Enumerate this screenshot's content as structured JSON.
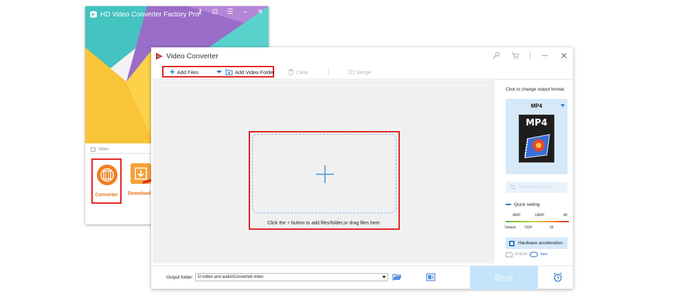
{
  "back_window": {
    "title": "HD Video Converter Factory Pro",
    "section_label": "Video",
    "tiles": [
      {
        "label": "Converter"
      },
      {
        "label": "Downloade"
      }
    ]
  },
  "main_window": {
    "title": "Video Converter",
    "toolbar": {
      "add_files": "Add Files",
      "add_video_folder": "Add Video Folder",
      "clear": "Clear",
      "merge": "Merge"
    },
    "drop_area": {
      "hint": "Click the + button to add files/folder,or drag files here."
    },
    "right_panel": {
      "output_format_label": "Click to change output format:",
      "format_name": "MP4",
      "format_thumb_text": "MP4",
      "edit_button": "Parameter settings",
      "quick_setting_label": "Quick setting",
      "resolutions_top": [
        "480P",
        "1080P",
        "4K"
      ],
      "resolutions_bottom": [
        "Default",
        "720P",
        "2K"
      ],
      "hardware_acceleration": "Hardware acceleration",
      "gpu_nvidia": "NVIDIA",
      "gpu_intel": "Intel"
    },
    "bottom_bar": {
      "output_folder_label": "Output folder:",
      "output_folder_value": "D:\\video and audio\\Converted video",
      "run_label": "Run"
    }
  },
  "colors": {
    "accent_blue": "#2d6fc7",
    "highlight_red": "#e0201f",
    "run_button_bg": "#c3e4fb",
    "format_card_bg": "#d6e9f8",
    "orange": "#f07f20"
  },
  "icons": [
    "app-logo-icon",
    "key-icon",
    "cart-icon",
    "minimize-icon",
    "close-icon",
    "trash-icon",
    "merge-icon",
    "folder-open-icon",
    "preview-icon",
    "alarm-clock-icon",
    "film-reel-icon",
    "download-icon"
  ]
}
